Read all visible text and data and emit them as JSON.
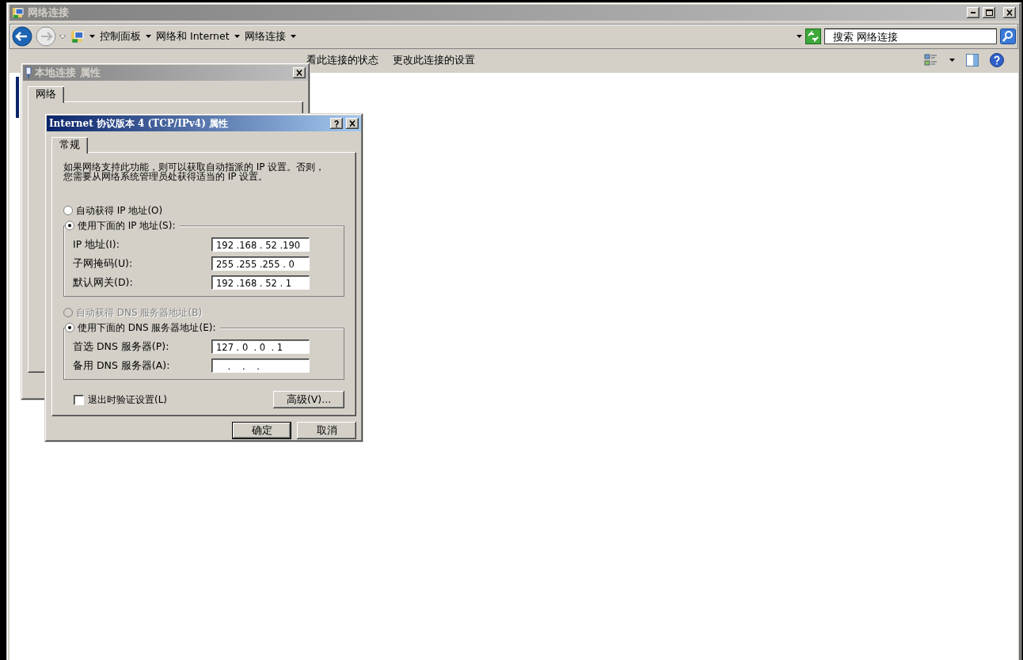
{
  "explorer": {
    "title": "网络连接",
    "breadcrumb": [
      "控制面板",
      "网络和 Internet",
      "网络连接"
    ],
    "search": {
      "placeholder": "搜索 网络连接"
    },
    "commands": [
      {
        "label": "看此连接的状态"
      },
      {
        "label": "更改此连接的设置"
      }
    ]
  },
  "properties_dialog": {
    "title": "本地连接 属性",
    "tabs": [
      {
        "label": "网络",
        "selected": true
      }
    ]
  },
  "ipv4_dialog": {
    "title": "Internet 协议版本 4 (TCP/IPv4) 属性",
    "tabs": [
      {
        "label": "常规",
        "selected": true
      }
    ],
    "description": "如果网络支持此功能，则可以获取自动指派的 IP 设置。否则，您需要从网络系统管理员处获得适当的 IP 设置。",
    "sections": [
      {
        "auto_option": {
          "label": "自动获得 IP 地址(O)",
          "selected": false,
          "disabled": false
        },
        "manual_option": {
          "label": "使用下面的 IP 地址(S):",
          "selected": true
        },
        "fields": [
          {
            "label": "IP 地址(I):",
            "value": "192 .168 . 52 .190"
          },
          {
            "label": "子网掩码(U):",
            "value": "255 .255 .255 . 0"
          },
          {
            "label": "默认网关(D):",
            "value": "192 .168 . 52 . 1"
          }
        ]
      },
      {
        "auto_option": {
          "label": "自动获得 DNS 服务器地址(B)",
          "selected": false,
          "disabled": true
        },
        "manual_option": {
          "label": "使用下面的 DNS 服务器地址(E):",
          "selected": true
        },
        "fields": [
          {
            "label": "首选 DNS 服务器(P):",
            "value": "127 . 0  . 0  . 1"
          },
          {
            "label": "备用 DNS 服务器(A):",
            "value": "    .    .    ."
          }
        ]
      }
    ],
    "validate_on_exit": {
      "label": "退出时验证设置(L)",
      "checked": false
    },
    "advanced_button": "高级(V)...",
    "buttons": [
      {
        "label": "确定",
        "default": true
      },
      {
        "label": "取消",
        "default": false
      }
    ]
  }
}
